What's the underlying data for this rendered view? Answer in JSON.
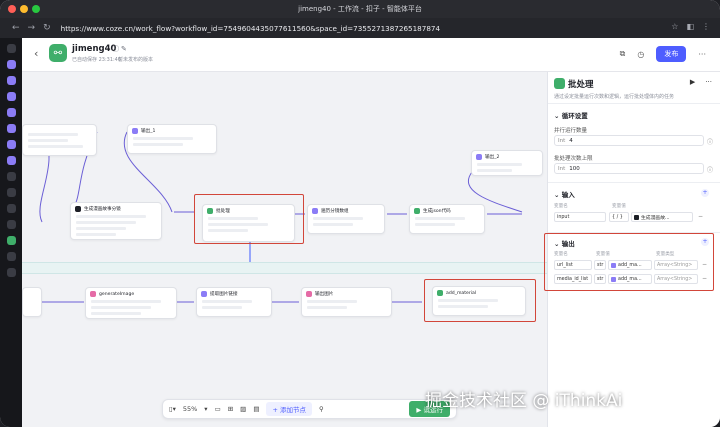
{
  "browser": {
    "window_title": "jimeng40 - 工作流 - 扣子 - 智能体平台",
    "url": "https://www.coze.cn/work_flow?workflow_id=7549604435077611560&space_id=7355271387265187874"
  },
  "header": {
    "app_name": "jimeng40",
    "status": "已自动保存 23:31:46",
    "subtitle": "暂未发布的版本",
    "publish_label": "发布"
  },
  "canvas": {
    "nodes": [
      {
        "title": "输出_1"
      },
      {
        "title": "生成漫画故事分镜"
      },
      {
        "title": "批处理"
      },
      {
        "title": "遍历分镜数组"
      },
      {
        "title": "生成json代码"
      },
      {
        "title": "输出_2"
      },
      {
        "title": "generateImage"
      },
      {
        "title": "提取图片链接"
      },
      {
        "title": "输出图片"
      },
      {
        "title": "add_material"
      }
    ],
    "zoom": "55%",
    "add_node_label": "添加节点",
    "run_label": "试运行"
  },
  "panel": {
    "title": "批处理",
    "description": "通过设定批量运行次数和逻辑，运行批处理体内的任务",
    "loop_section": "循环设置",
    "parallel_label": "并行运行数量",
    "parallel_type": "Int",
    "parallel_value": "4",
    "max_label": "批处理次数上限",
    "max_type": "Int",
    "max_value": "100",
    "input_section": "输入",
    "input_col_name": "变量名",
    "input_col_value": "变量值",
    "input_name": "input",
    "input_type": "{ / }",
    "input_value": "生成漫画故...",
    "output_section": "输出",
    "output_col_name": "变量名",
    "output_col_value": "变量值",
    "output_col_type": "变量类型",
    "outputs": [
      {
        "name": "url_list",
        "kind": "str",
        "value": "add_ma...",
        "type": "Array<String>"
      },
      {
        "name": "media_id_list",
        "kind": "str",
        "value": "add_ma...",
        "type": "Array<String>"
      }
    ]
  },
  "watermark": "掘金技术社区 @ iThinkAi"
}
